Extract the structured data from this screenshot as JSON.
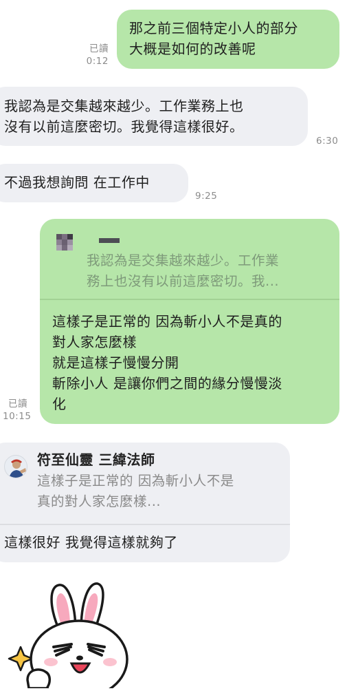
{
  "messages": [
    {
      "id": "m1",
      "direction": "outgoing",
      "lines": [
        "那之前三個特定小人的部分",
        "大概是如何的改善呢"
      ],
      "read_label": "已讀",
      "time": "0:12"
    },
    {
      "id": "m2",
      "direction": "incoming",
      "lines": [
        "我認為是交集越來越少。工作業務上也",
        "沒有以前這麼密切。我覺得這樣很好。"
      ],
      "time": "6:30"
    },
    {
      "id": "m3",
      "direction": "incoming",
      "lines": [
        "不過我想詢問 在工作中"
      ],
      "time": "9:25"
    },
    {
      "id": "m4",
      "direction": "outgoing",
      "reply_quote": {
        "lines": [
          "我認為是交集越來越少。工作業",
          "務上也沒有以前這麼密切。我..."
        ]
      },
      "lines": [
        "這樣子是正常的 因為斬小人不是真的",
        "對人家怎麼樣",
        "就是這樣子慢慢分開",
        "斬除小人 是讓你們之間的緣分慢慢淡",
        "化"
      ],
      "read_label": "已讀",
      "time": "10:15"
    },
    {
      "id": "m5",
      "direction": "incoming",
      "reply_quote": {
        "sender": "符至仙靈 三緯法師",
        "lines": [
          "這樣子是正常的 因為斬小人不是",
          "真的對人家怎麼樣..."
        ]
      },
      "lines": [
        "這樣很好 我覺得這樣就夠了"
      ]
    },
    {
      "id": "m6",
      "direction": "incoming",
      "type": "sticker",
      "sticker": "cony-rabbit-thumbs-up"
    }
  ],
  "colors": {
    "outgoing_bubble": "#b6e6a9",
    "incoming_bubble": "#eeeff3",
    "timestamp": "#8c8c8c",
    "quote_text_outgoing": "#7e9a7a",
    "quote_text_incoming": "#8a8a8a"
  }
}
